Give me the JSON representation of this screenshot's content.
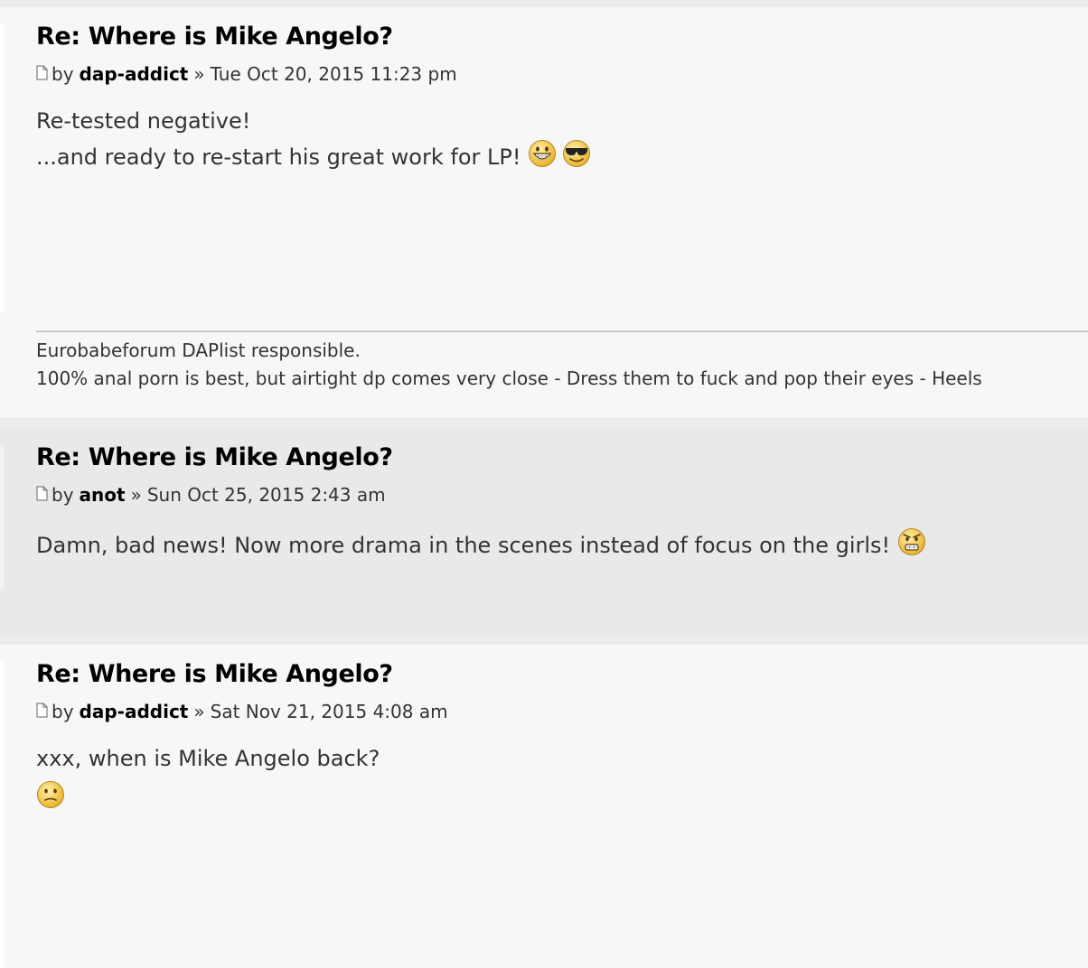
{
  "posts": [
    {
      "title": "Re: Where is Mike Angelo?",
      "by_label": "by",
      "author": "dap-addict",
      "separator": "»",
      "date": "Tue Oct 20, 2015 11:23 pm",
      "content": {
        "line1": "Re-tested negative!",
        "line2": "...and ready to re-start his great work for LP!",
        "smileys": [
          "grin-smiley-icon",
          "cool-smiley-icon"
        ]
      },
      "signature": {
        "line1": "Eurobabeforum DAPlist responsible.",
        "line2": "100% anal porn is best, but airtight dp comes very close - Dress them to fuck and pop their eyes - Heels"
      }
    },
    {
      "title": "Re: Where is Mike Angelo?",
      "by_label": "by",
      "author": "anot",
      "separator": "»",
      "date": "Sun Oct 25, 2015 2:43 am",
      "content": {
        "line1": "Damn, bad news! Now more drama in the scenes instead of focus on the girls!",
        "smileys": [
          "mad-smiley-icon"
        ]
      }
    },
    {
      "title": "Re: Where is Mike Angelo?",
      "by_label": "by",
      "author": "dap-addict",
      "separator": "»",
      "date": "Sat Nov 21, 2015 4:08 am",
      "content": {
        "line1": "xxx, when is Mike Angelo back?",
        "smileys": [
          "confused-smiley-icon"
        ]
      }
    }
  ],
  "colors": {
    "post_bg_light": "#f7f7f7",
    "post_bg_dark": "#e9e9e9",
    "title": "#000000",
    "text": "#333333",
    "smiley_yellow": "#f5c542"
  }
}
